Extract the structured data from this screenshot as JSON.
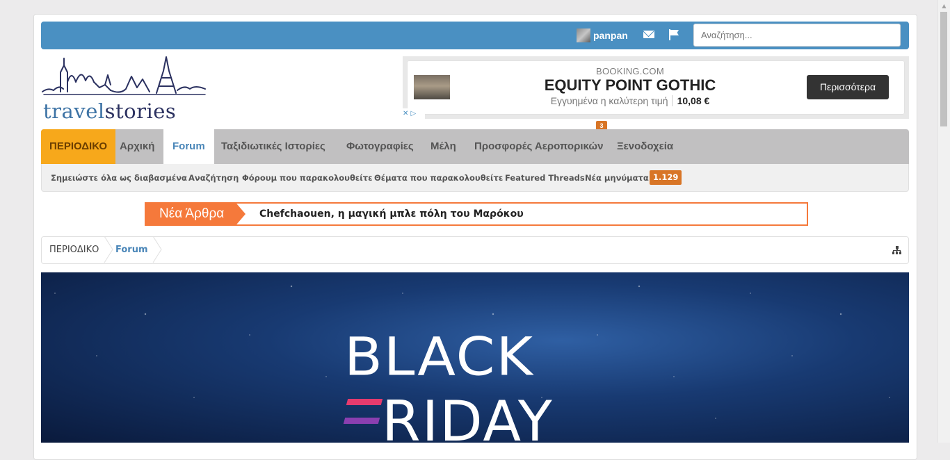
{
  "topbar": {
    "username": "panpan",
    "search_placeholder": "Αναζήτηση..."
  },
  "logo": {
    "part1": "travel",
    "part2": "stories"
  },
  "ad": {
    "source": "BOOKING.COM",
    "title": "EQUITY POINT GOTHIC",
    "subtitle": "Εγγυημένα η καλύτερη τιμή",
    "price": "10,08 €",
    "button": "Περισσότερα",
    "choices": "✕ ▷"
  },
  "nav": {
    "items": [
      {
        "label": "ΠΕΡΙΟΔΙΚΟ"
      },
      {
        "label": "Αρχική"
      },
      {
        "label": "Forum"
      },
      {
        "label": "Ταξιδιωτικές Ιστορίες"
      },
      {
        "label": "Φωτογραφίες"
      },
      {
        "label": "Μέλη"
      },
      {
        "label": "Προσφορές Αεροπορικών"
      },
      {
        "label": "Ξενοδοχεία"
      }
    ],
    "badge": "3"
  },
  "subnav": {
    "items": [
      {
        "label": "Σημειώστε όλα ως διαβασμένα"
      },
      {
        "label": "Αναζήτηση"
      },
      {
        "label": "Φόρουμ που παρακολουθείτε"
      },
      {
        "label": "Θέματα που παρακολουθείτε"
      },
      {
        "label": "Featured Threads"
      },
      {
        "label": "Νέα μηνύματα"
      }
    ],
    "new_count": "1.129"
  },
  "ticker": {
    "label": "Νέα Άρθρα",
    "headline": "Chefchaouen, η μαγική μπλε πόλη του Μαρόκου"
  },
  "breadcrumb": {
    "home": "ΠΕΡΙΟΔΙΚΟ",
    "current": "Forum"
  },
  "banner": {
    "line1": "BLACK",
    "line2": "RIDAY"
  }
}
